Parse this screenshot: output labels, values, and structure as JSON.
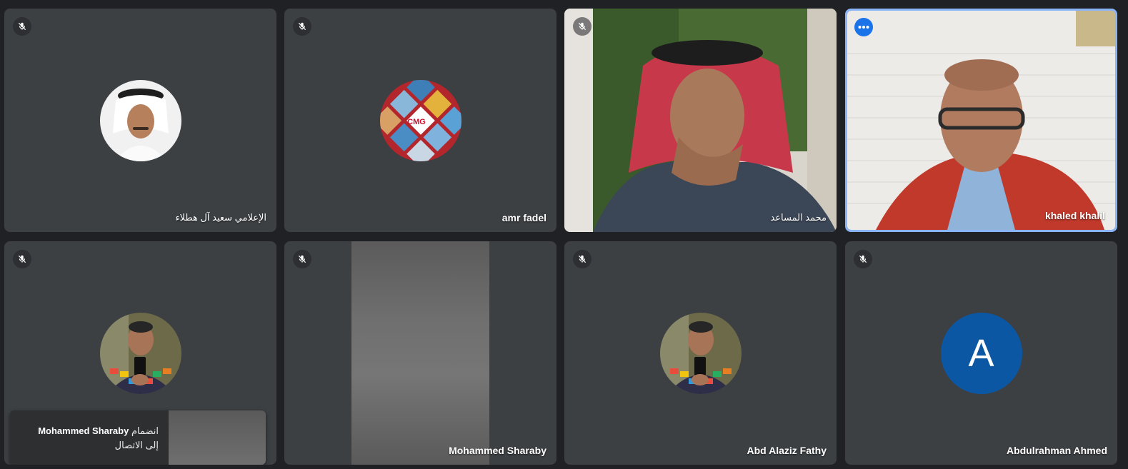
{
  "participants": [
    {
      "name": "الإعلامي سعيد آل هطلاء",
      "mic": "muted"
    },
    {
      "name": "amr fadel",
      "mic": "muted",
      "avatar_text": "CMG"
    },
    {
      "name": "محمد المساعد",
      "mic": "muted"
    },
    {
      "name": "khaled khalil",
      "active": true
    },
    {
      "name": "",
      "mic": "muted"
    },
    {
      "name": "Mohammed Sharaby",
      "mic": "muted"
    },
    {
      "name": "Abd Alaziz Fathy",
      "mic": "muted"
    },
    {
      "name": "Abdulrahman Ahmed",
      "mic": "muted",
      "avatar_letter": "A",
      "avatar_color": "#0b57a4"
    }
  ],
  "toast": {
    "name": "Mohammed Sharaby",
    "prefix": "انضمام",
    "suffix": "إلى الاتصال"
  },
  "colors": {
    "background": "#202124",
    "tile": "#3c4043",
    "active_border": "#8ab4f8",
    "more_button": "#1a73e8"
  },
  "icons": {
    "muted": "mic-off-icon",
    "more": "more-options-icon"
  }
}
